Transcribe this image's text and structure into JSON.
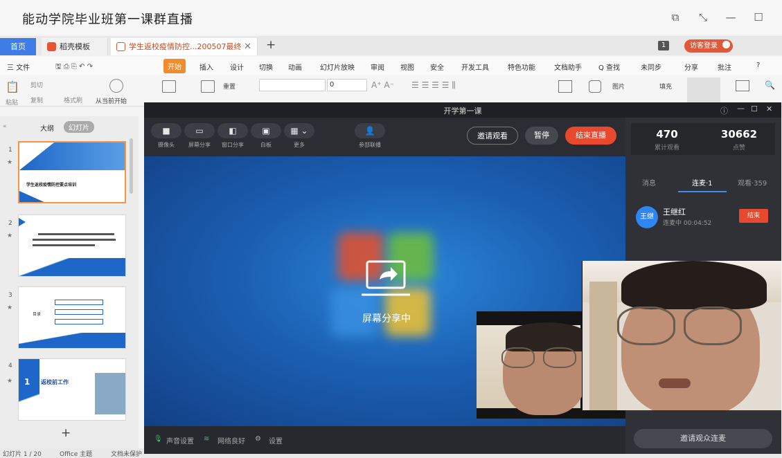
{
  "window": {
    "title": "能动学院毕业班第一课群直播"
  },
  "tabs": {
    "home": "首页",
    "template": "稻壳模板",
    "doc": "学生返校疫情防控...200507最终",
    "count": "1",
    "login": "访客登录"
  },
  "menu": {
    "file": "三 文件",
    "items": [
      "开始",
      "插入",
      "设计",
      "切换",
      "动画",
      "幻灯片放映",
      "审阅",
      "视图",
      "安全",
      "开发工具",
      "特色功能",
      "文档助手",
      "Q 查找"
    ],
    "right": [
      "未同步",
      "分享",
      "批注",
      "?"
    ]
  },
  "ribbon": {
    "cut": "剪切",
    "copy": "复制",
    "paste": "粘贴",
    "painter": "格式刷",
    "from_current": "从当前开始",
    "reset": "重置",
    "font_size": "0",
    "image": "图片",
    "fill": "填充"
  },
  "slides": {
    "tabs": [
      "大纲",
      "幻灯片"
    ],
    "nums": [
      "1",
      "2",
      "3",
      "4"
    ],
    "slide1_title": "学生返校疫情防控要点培训",
    "slide4_num": "1",
    "slide4_title": "返校前工作",
    "slide3_label": "目录",
    "add": "+"
  },
  "status": {
    "page": "幻灯片 1 / 20",
    "theme": "Office 主题",
    "protect": "文档未保护"
  },
  "live": {
    "title": "开学第一课",
    "tools": [
      {
        "icon": "camera-icon",
        "label": "摄像头"
      },
      {
        "icon": "screen-share-icon",
        "label": "屏幕分享"
      },
      {
        "icon": "window-share-icon",
        "label": "窗口分享"
      },
      {
        "icon": "whiteboard-icon",
        "label": "白板"
      },
      {
        "icon": "more-icon",
        "label": "更多"
      },
      {
        "icon": "members-icon",
        "label": "参部联播"
      }
    ],
    "invite": "邀请观看",
    "pause": "暂停",
    "end": "结束直播",
    "sharing": "屏幕分享中",
    "stats": [
      {
        "value": "470",
        "label": "累计观看"
      },
      {
        "value": "30662",
        "label": "点赞"
      }
    ],
    "right_tabs": [
      "消息",
      "连麦·1",
      "观看·359"
    ],
    "caller": {
      "avatar": "王继",
      "name": "王继红",
      "status": "连麦中 00:04:52",
      "end": "结束"
    },
    "bottom": {
      "audio": "声音设置",
      "network": "网络良好",
      "settings": "设置"
    },
    "invite_mic": "邀请观众连麦"
  },
  "colors": {
    "accent": "#f08c2b",
    "end_red": "#e8492e",
    "blue": "#3e7ce6"
  }
}
